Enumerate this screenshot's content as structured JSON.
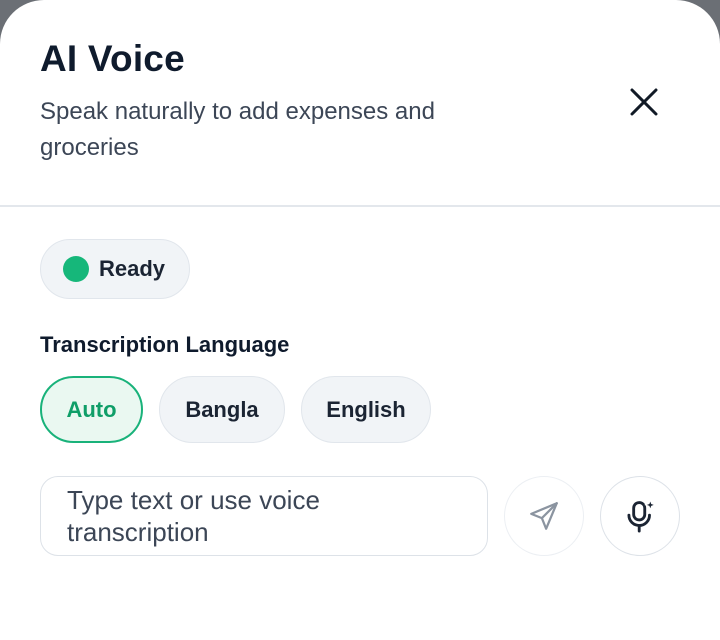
{
  "dialog": {
    "title": "AI Voice",
    "subtitle": "Speak naturally to add expenses and groceries"
  },
  "status": {
    "label": "Ready",
    "color": "#16b77a"
  },
  "language": {
    "section_label": "Transcription Language",
    "options": [
      {
        "label": "Auto",
        "selected": true
      },
      {
        "label": "Bangla",
        "selected": false
      },
      {
        "label": "English",
        "selected": false
      }
    ]
  },
  "composer": {
    "placeholder": "Type text or use voice transcription",
    "send_icon": "send-icon",
    "mic_icon": "mic-sparkle-icon"
  },
  "colors": {
    "accent": "#19b27a",
    "accent_text": "#0f9e68",
    "chip_bg": "#f1f4f7"
  }
}
